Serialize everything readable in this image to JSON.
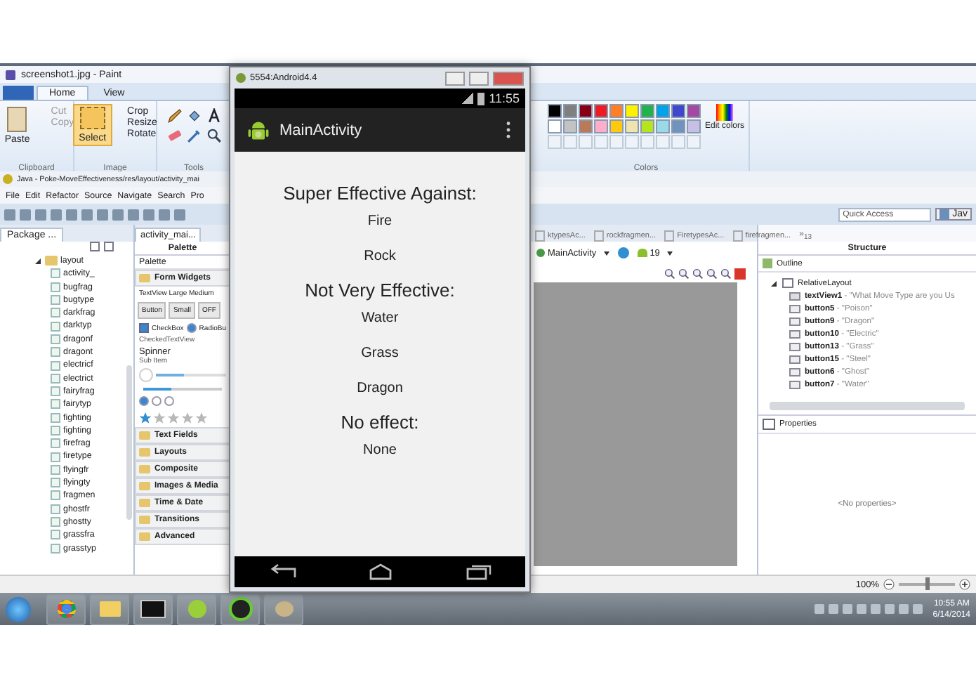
{
  "paint": {
    "title": "screenshot1.jpg - Paint",
    "tabs": [
      {
        "label": "Home",
        "selected": true
      },
      {
        "label": "View",
        "selected": false
      }
    ],
    "clipboard": {
      "label": "Clipboard",
      "paste": "Paste",
      "items": [
        {
          "label": "Cut",
          "disabled": true
        },
        {
          "label": "Copy",
          "disabled": true
        }
      ]
    },
    "image": {
      "label": "Image",
      "select": {
        "label": "Select",
        "selected": true
      },
      "items": [
        "Crop",
        "Resize",
        "Rotate"
      ]
    },
    "tools": {
      "label": "Tools"
    },
    "colors": {
      "label": "Colors",
      "edit": "Edit colors",
      "swatches": [
        {
          "color": "#000000"
        },
        {
          "color": "#7f7f7f"
        },
        {
          "color": "#880015"
        },
        {
          "color": "#ed1c24"
        },
        {
          "color": "#ff7f27"
        },
        {
          "color": "#fff200"
        },
        {
          "color": "#22b14c"
        },
        {
          "color": "#00a2e8"
        },
        {
          "color": "#3f48cc"
        },
        {
          "color": "#a349a4"
        },
        {
          "color": "#ffffff"
        },
        {
          "color": "#c3c3c3"
        },
        {
          "color": "#b97a57"
        },
        {
          "color": "#ffaec9"
        },
        {
          "color": "#ffc90e"
        },
        {
          "color": "#efe4b0"
        },
        {
          "color": "#b5e61d"
        },
        {
          "color": "#99d9ea"
        },
        {
          "color": "#7092be"
        },
        {
          "color": "#c8bfe7"
        }
      ]
    }
  },
  "eclipse": {
    "title": "Java - Poke-MoveEffectiveness/res/layout/activity_mai",
    "menu": [
      "File",
      "Edit",
      "Refactor",
      "Source",
      "Navigate",
      "Search",
      "Pro"
    ],
    "quick_access": {
      "placeholder": "Quick Access"
    },
    "perspective": "Jav",
    "package_explorer": {
      "title": "Package ...",
      "tree": [
        {
          "label": "layout",
          "expanded": true,
          "children": [
            {
              "label": "activity_"
            },
            {
              "label": "bugfrag"
            },
            {
              "label": "bugtype"
            },
            {
              "label": "darkfrag"
            },
            {
              "label": "darktyp"
            },
            {
              "label": "dragonf"
            },
            {
              "label": "dragont"
            },
            {
              "label": "electricf"
            },
            {
              "label": "electrict"
            },
            {
              "label": "fairyfrag"
            },
            {
              "label": "fairytyp"
            },
            {
              "label": "fighting"
            },
            {
              "label": "fighting"
            },
            {
              "label": "firefrag"
            },
            {
              "label": "firetype"
            },
            {
              "label": "flyingfr"
            },
            {
              "label": "flyingty"
            },
            {
              "label": "fragmen"
            },
            {
              "label": "ghostfr"
            },
            {
              "label": "ghostty"
            },
            {
              "label": "grassfra"
            },
            {
              "label": "grasstyp"
            }
          ]
        }
      ]
    },
    "palette": {
      "tab": "activity_mai...",
      "header": "Palette",
      "title": "Palette",
      "open_category": "Form Widgets",
      "text_sizes": "TextView Large Medium",
      "buttons": [
        "Button",
        "Small",
        "OFF"
      ],
      "checkbox": {
        "label": "CheckBox",
        "checked": true
      },
      "radio": {
        "label": "RadioBu",
        "selected": true
      },
      "radios": [
        {
          "selected": true
        },
        {
          "selected": false
        },
        {
          "selected": false
        }
      ],
      "checked_text": "CheckedTextView",
      "spinner": "Spinner",
      "sub_item": "Sub Item",
      "progress": {
        "level": 0.4
      },
      "seekbar": {
        "level": 0.35
      },
      "stars": 1,
      "categories": [
        "Text Fields",
        "Layouts",
        "Composite",
        "Images & Media",
        "Time & Date",
        "Transitions",
        "Advanced"
      ]
    },
    "editor": {
      "tabs": [
        "ktypesAc...",
        "rockfragmen...",
        "FiretypesAc...",
        "firefragmen..."
      ],
      "overflow": "»$_{13}$",
      "activity": "MainActivity",
      "api": "19"
    },
    "outline": {
      "header": "Structure",
      "title": "Outline",
      "tree": [
        {
          "label": "RelativeLayout",
          "expanded": true,
          "children": [
            {
              "kind": "text",
              "name": "textView1",
              "value": "- \"What Move Type are you Us"
            },
            {
              "kind": "button",
              "name": "button5",
              "value": "- \"Poison\""
            },
            {
              "kind": "button",
              "name": "button9",
              "value": "- \"Dragon\""
            },
            {
              "kind": "button",
              "name": "button10",
              "value": "- \"Electric\""
            },
            {
              "kind": "button",
              "name": "button13",
              "value": "- \"Grass\""
            },
            {
              "kind": "button",
              "name": "button15",
              "value": "- \"Steel\""
            },
            {
              "kind": "button",
              "name": "button6",
              "value": "- \"Ghost\""
            },
            {
              "kind": "button",
              "name": "button7",
              "value": "- \"Water\""
            }
          ]
        }
      ]
    },
    "properties": {
      "title": "Properties",
      "empty": "<No properties>"
    },
    "status_bar": {
      "zoom": "100%",
      "level": 0.5
    }
  },
  "emulator": {
    "title": "5554:Android4.4",
    "time": "11:55",
    "app_title": "MainActivity",
    "lines": [
      {
        "kind": "heading",
        "text": "Super Effective Against:"
      },
      {
        "kind": "entry",
        "text": "Fire"
      },
      {
        "kind": "entry",
        "text": "Rock"
      },
      {
        "kind": "heading",
        "text": "Not Very Effective:"
      },
      {
        "kind": "entry",
        "text": "Water"
      },
      {
        "kind": "entry",
        "text": "Grass"
      },
      {
        "kind": "entry",
        "text": "Dragon"
      },
      {
        "kind": "heading",
        "text": "No effect:"
      },
      {
        "kind": "entry",
        "text": "None"
      }
    ]
  },
  "taskbar": {
    "time": "10:55 AM",
    "date": "6/14/2014"
  }
}
